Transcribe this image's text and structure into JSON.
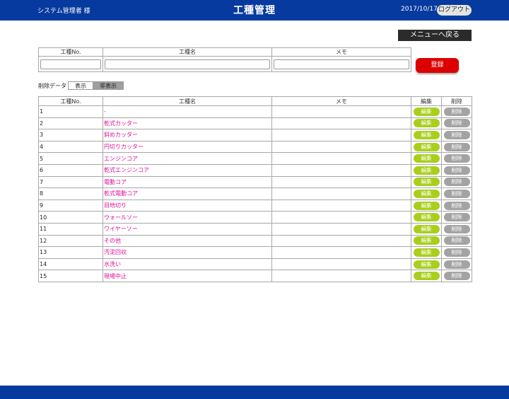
{
  "header": {
    "user": "システム管理者 様",
    "title": "工種管理",
    "date": "2017/10/17",
    "logout_label": "ログアウト"
  },
  "menu_back_label": "メニューへ戻る",
  "form": {
    "col_no": "工種No.",
    "col_name": "工種名",
    "col_memo": "メモ",
    "no_value": "",
    "name_value": "",
    "memo_value": "",
    "register_label": "登録"
  },
  "deleted_filter": {
    "label": "削除データ",
    "show_label": "表示",
    "hide_label": "非表示",
    "selected": "非表示"
  },
  "list": {
    "headers": {
      "no": "工種No.",
      "name": "工種名",
      "memo": "メモ",
      "edit": "編集",
      "delete": "削除"
    },
    "edit_label": "編集",
    "delete_label": "削除",
    "rows": [
      {
        "no": "1",
        "name": "-",
        "memo": ""
      },
      {
        "no": "2",
        "name": "乾式カッター",
        "memo": ""
      },
      {
        "no": "3",
        "name": "斜めカッター",
        "memo": ""
      },
      {
        "no": "4",
        "name": "円切りカッター",
        "memo": ""
      },
      {
        "no": "5",
        "name": "エンジンコア",
        "memo": ""
      },
      {
        "no": "6",
        "name": "乾式エンジンコア",
        "memo": ""
      },
      {
        "no": "7",
        "name": "電動コア",
        "memo": ""
      },
      {
        "no": "8",
        "name": "乾式電動コア",
        "memo": ""
      },
      {
        "no": "9",
        "name": "目地切り",
        "memo": ""
      },
      {
        "no": "10",
        "name": "ウォールソー",
        "memo": ""
      },
      {
        "no": "11",
        "name": "ワイヤーソー",
        "memo": ""
      },
      {
        "no": "12",
        "name": "その他",
        "memo": ""
      },
      {
        "no": "13",
        "name": "汚泥回収",
        "memo": ""
      },
      {
        "no": "14",
        "name": "水洗い",
        "memo": ""
      },
      {
        "no": "15",
        "name": "現場中止",
        "memo": ""
      }
    ]
  },
  "colors": {
    "header_bg": "#073a9e",
    "link_text": "#e0119a",
    "edit_button": "#a9cf1c",
    "delete_button": "#a3a3a3",
    "register_button": "#dd0000"
  }
}
